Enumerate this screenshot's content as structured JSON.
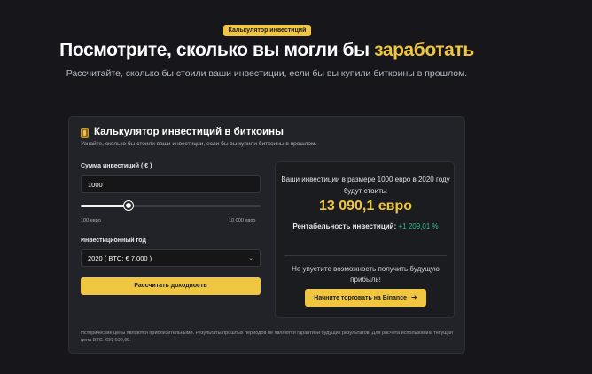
{
  "badge": "Калькулятор инвестиций",
  "hero": {
    "title_white": "Посмотрите, сколько вы могли бы ",
    "title_yellow": "заработать",
    "subtitle": "Рассчитайте, сколько бы стоили ваши инвестиции, если бы вы купили биткоины в прошлом."
  },
  "card": {
    "title": "Калькулятор инвестиций в биткоины",
    "subtitle": "Узнайте, сколько бы стоили ваши инвестиции, если бы вы купили биткоины в прошлом.",
    "amount_label": "Сумма инвестиций ( € )",
    "amount_value": "1000",
    "slider": {
      "min_label": "100 евро",
      "max_label": "10 000 евро",
      "min": 100,
      "max": 10000,
      "value": 1000
    },
    "year_label": "Инвестиционный год",
    "year_value": "2020 ( BTC: € 7,000 )",
    "calculate_button": "Рассчитать доходность",
    "result": {
      "text": "Ваши инвестиции в размере 1000 евро в 2020 году будут стоить:",
      "amount": "13 090,1 евро",
      "roi_label": "Рентабельность инвестиций:",
      "roi_value": "+1 209,01 %",
      "cta_text": "Не упустите возможность получить будущую прибыль!",
      "trade_button": "Начните торговать на Binance",
      "trade_arrow": "➔"
    },
    "disclaimer": "Исторические цены являются приблизительными. Результаты прошлых периодов не являются гарантией будущих результатов. Для расчета использована текущая цена BTC: €91 630,68."
  },
  "colors": {
    "accent": "#f0c641",
    "background": "#17171b",
    "card": "#222328",
    "positive": "#2ebd85"
  },
  "icons": {
    "card_icon": "bitcoin-wallet-icon",
    "chevron": "chevron-down-icon",
    "arrow": "arrow-right-icon"
  }
}
